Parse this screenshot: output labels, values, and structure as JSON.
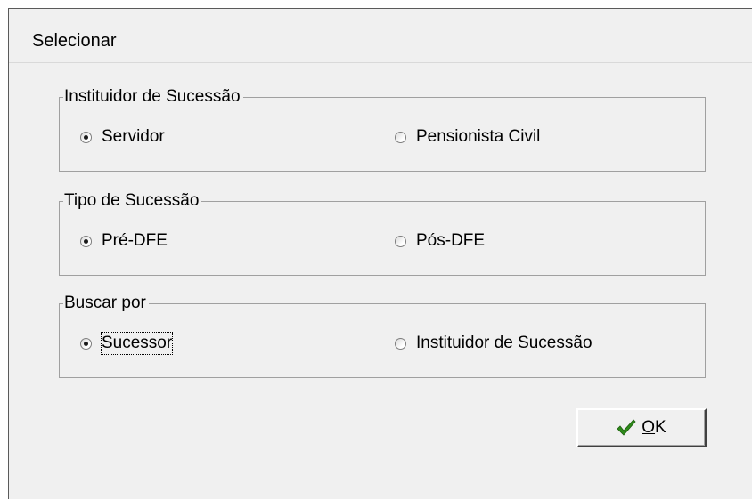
{
  "window": {
    "title": "Selecionar"
  },
  "groups": [
    {
      "legend": "Instituidor de Sucessão",
      "options": [
        {
          "label": "Servidor",
          "selected": true
        },
        {
          "label": "Pensionista Civil",
          "selected": false
        }
      ]
    },
    {
      "legend": "Tipo de Sucessão",
      "options": [
        {
          "label": "Pré-DFE",
          "selected": true
        },
        {
          "label": "Pós-DFE",
          "selected": false
        }
      ]
    },
    {
      "legend": "Buscar por",
      "options": [
        {
          "label": "Sucessor",
          "selected": true,
          "focused": true
        },
        {
          "label": "Instituidor de Sucessão",
          "selected": false
        }
      ]
    }
  ],
  "ok_button": {
    "accel": "O",
    "rest": "K",
    "icon": "checkmark-icon",
    "icon_color": "#2e8b1a"
  }
}
